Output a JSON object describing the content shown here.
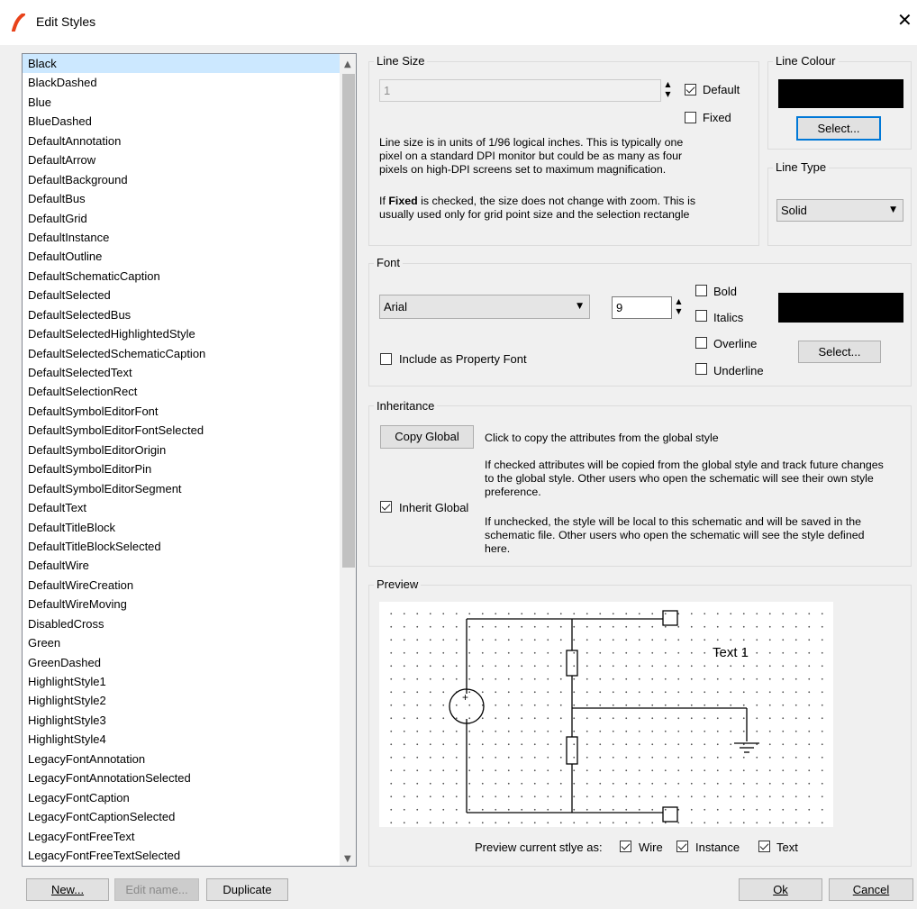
{
  "window": {
    "title": "Edit Styles",
    "close_glyph": "✕"
  },
  "styles_list": {
    "selected_index": 0,
    "items": [
      "Black",
      "BlackDashed",
      "Blue",
      "BlueDashed",
      "DefaultAnnotation",
      "DefaultArrow",
      "DefaultBackground",
      "DefaultBus",
      "DefaultGrid",
      "DefaultInstance",
      "DefaultOutline",
      "DefaultSchematicCaption",
      "DefaultSelected",
      "DefaultSelectedBus",
      "DefaultSelectedHighlightedStyle",
      "DefaultSelectedSchematicCaption",
      "DefaultSelectedText",
      "DefaultSelectionRect",
      "DefaultSymbolEditorFont",
      "DefaultSymbolEditorFontSelected",
      "DefaultSymbolEditorOrigin",
      "DefaultSymbolEditorPin",
      "DefaultSymbolEditorSegment",
      "DefaultText",
      "DefaultTitleBlock",
      "DefaultTitleBlockSelected",
      "DefaultWire",
      "DefaultWireCreation",
      "DefaultWireMoving",
      "DisabledCross",
      "Green",
      "GreenDashed",
      "HighlightStyle1",
      "HighlightStyle2",
      "HighlightStyle3",
      "HighlightStyle4",
      "LegacyFontAnnotation",
      "LegacyFontAnnotationSelected",
      "LegacyFontCaption",
      "LegacyFontCaptionSelected",
      "LegacyFontFreeText",
      "LegacyFontFreeTextSelected"
    ]
  },
  "bottom_left": {
    "new_label": "New...",
    "edit_name_label": "Edit name...",
    "duplicate_label": "Duplicate"
  },
  "line_size": {
    "group_label": "Line Size",
    "value": "1",
    "default_label": "Default",
    "default_checked": true,
    "fixed_label": "Fixed",
    "fixed_checked": false,
    "help1": "Line size is in units of 1/96 logical inches. This is typically one pixel on a standard DPI monitor but could be as many as four pixels on high-DPI screens set to maximum magnification.",
    "help2_pre": "If ",
    "help2_bold": "Fixed",
    "help2_post": " is checked, the size does not change with zoom. This is usually used only for grid point size and the selection rectangle"
  },
  "line_colour": {
    "group_label": "Line Colour",
    "colour": "#000000",
    "select_label": "Select..."
  },
  "line_type": {
    "group_label": "Line Type",
    "value": "Solid"
  },
  "font": {
    "group_label": "Font",
    "family": "Arial",
    "size": "9",
    "bold_label": "Bold",
    "bold_checked": false,
    "italics_label": "Italics",
    "italics_checked": false,
    "overline_label": "Overline",
    "overline_checked": false,
    "underline_label": "Underline",
    "underline_checked": false,
    "include_label": "Include as Property Font",
    "include_checked": false,
    "colour": "#000000",
    "select_label": "Select..."
  },
  "inheritance": {
    "group_label": "Inheritance",
    "copy_global_label": "Copy Global",
    "copy_global_desc": "Click to copy the attributes from the global style",
    "inherit_label": "Inherit Global",
    "inherit_checked": true,
    "checked_desc": "If checked attributes will be copied from the global style and track future changes to the global style. Other users who open the schematic will see their own style preference.",
    "unchecked_desc": "If unchecked, the style will be local to this schematic and will be saved in the schematic file. Other users who open the schematic will see the style defined here."
  },
  "preview": {
    "group_label": "Preview",
    "sample_text": "Text 1",
    "source_symbol": "+",
    "preview_as_label": "Preview current stlye as:",
    "wire_label": "Wire",
    "wire_checked": true,
    "instance_label": "Instance",
    "instance_checked": true,
    "text_label": "Text",
    "text_checked": true
  },
  "footer": {
    "ok_label": "Ok",
    "cancel_label": "Cancel"
  },
  "icons": {
    "app": "app-logo-icon",
    "close": "close-icon"
  },
  "colors": {
    "selection": "#cce8ff",
    "focus_border": "#0078d7",
    "background": "#f0f0f0",
    "app_logo": "#e8421a"
  }
}
